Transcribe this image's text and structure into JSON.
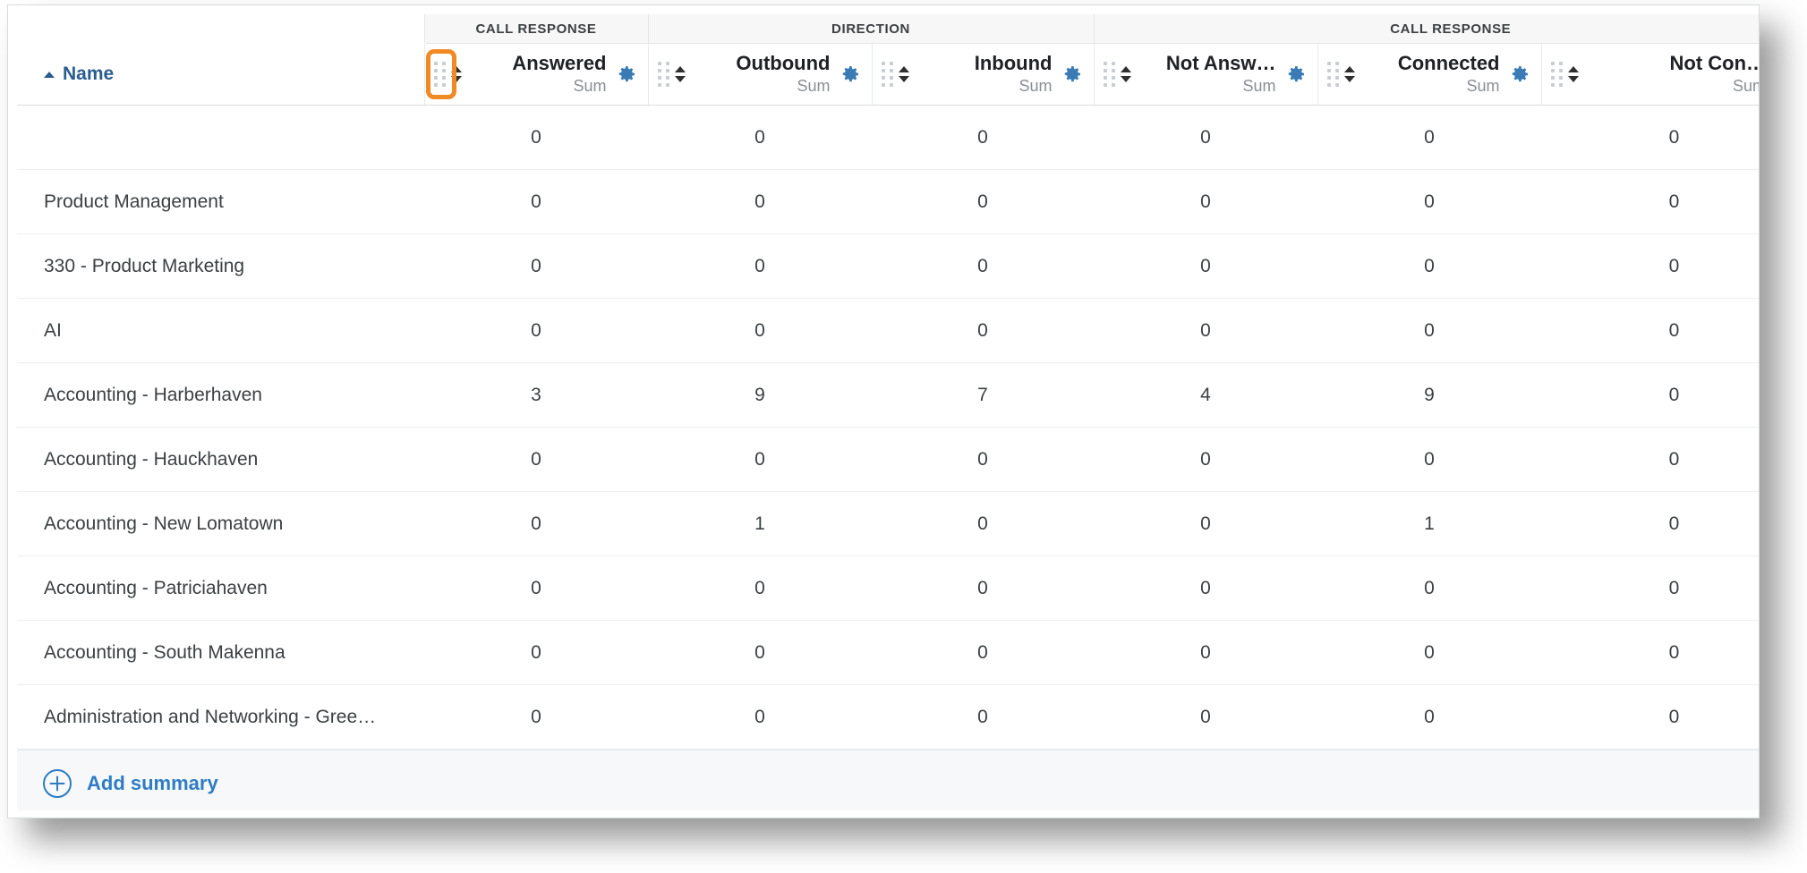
{
  "table": {
    "name_column": {
      "label": "Name",
      "sort": "ascending",
      "sort_icon": "triangle-up-icon"
    },
    "group_headers": [
      {
        "label": "CALL RESPONSE",
        "span": 1
      },
      {
        "label": "DIRECTION",
        "span": 2
      },
      {
        "label": "CALL RESPONSE",
        "span": 3
      }
    ],
    "columns": [
      {
        "label": "Answered",
        "aggregation": "Sum",
        "drag_icon": "drag-handle-icon",
        "sort_icon": "sort-arrows-icon",
        "settings_icon": "gear-icon",
        "highlighted": true
      },
      {
        "label": "Outbound",
        "aggregation": "Sum",
        "drag_icon": "drag-handle-icon",
        "sort_icon": "sort-arrows-icon",
        "settings_icon": "gear-icon",
        "highlighted": false
      },
      {
        "label": "Inbound",
        "aggregation": "Sum",
        "drag_icon": "drag-handle-icon",
        "sort_icon": "sort-arrows-icon",
        "settings_icon": "gear-icon",
        "highlighted": false
      },
      {
        "label": "Not Answ…",
        "aggregation": "Sum",
        "drag_icon": "drag-handle-icon",
        "sort_icon": "sort-arrows-icon",
        "settings_icon": "gear-icon",
        "highlighted": false
      },
      {
        "label": "Connected",
        "aggregation": "Sum",
        "drag_icon": "drag-handle-icon",
        "sort_icon": "sort-arrows-icon",
        "settings_icon": "gear-icon",
        "highlighted": false
      },
      {
        "label": "Not Con…",
        "aggregation": "Sum",
        "drag_icon": "drag-handle-icon",
        "sort_icon": "sort-arrows-icon",
        "settings_icon": "gear-icon",
        "highlighted": false
      }
    ],
    "rows": [
      {
        "name": "",
        "values": [
          "0",
          "0",
          "0",
          "0",
          "0",
          "0"
        ]
      },
      {
        "name": "Product Management",
        "values": [
          "0",
          "0",
          "0",
          "0",
          "0",
          "0"
        ]
      },
      {
        "name": "330 - Product Marketing",
        "values": [
          "0",
          "0",
          "0",
          "0",
          "0",
          "0"
        ]
      },
      {
        "name": "AI",
        "values": [
          "0",
          "0",
          "0",
          "0",
          "0",
          "0"
        ]
      },
      {
        "name": "Accounting - Harberhaven",
        "values": [
          "3",
          "9",
          "7",
          "4",
          "9",
          "0"
        ]
      },
      {
        "name": "Accounting - Hauckhaven",
        "values": [
          "0",
          "0",
          "0",
          "0",
          "0",
          "0"
        ]
      },
      {
        "name": "Accounting - New Lomatown",
        "values": [
          "0",
          "1",
          "0",
          "0",
          "1",
          "0"
        ]
      },
      {
        "name": "Accounting - Patriciahaven",
        "values": [
          "0",
          "0",
          "0",
          "0",
          "0",
          "0"
        ]
      },
      {
        "name": "Accounting - South Makenna",
        "values": [
          "0",
          "0",
          "0",
          "0",
          "0",
          "0"
        ]
      },
      {
        "name": "Administration and Networking - Gree…",
        "values": [
          "0",
          "0",
          "0",
          "0",
          "0",
          "0"
        ]
      }
    ]
  },
  "footer": {
    "add_summary_label": "Add summary",
    "add_summary_icon": "plus-circle-icon"
  },
  "colors": {
    "highlight": "#f08a24",
    "gear": "#3b7bb5",
    "link": "#2d7cc4",
    "name_header": "#2a5d8f"
  }
}
